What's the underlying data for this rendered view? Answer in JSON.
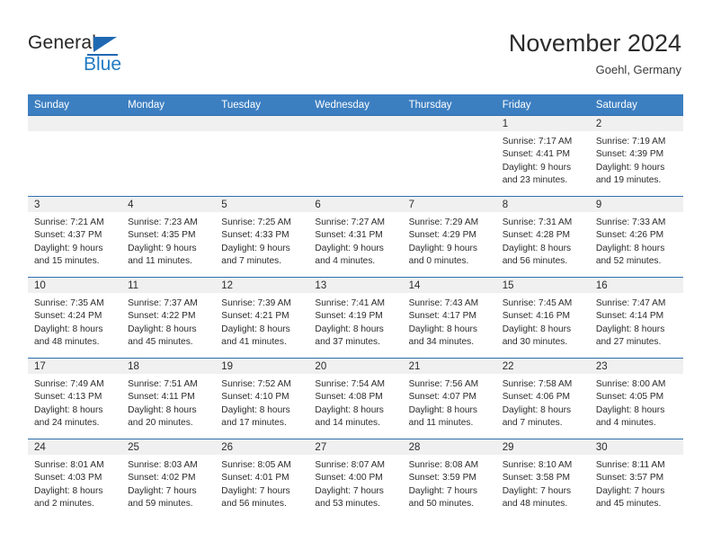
{
  "brand": {
    "name_part1": "General",
    "name_part2": "Blue",
    "logo_icon": "triangle-flag-icon",
    "accent_color": "#1f7ac4"
  },
  "header": {
    "title": "November 2024",
    "subtitle": "Goehl, Germany"
  },
  "theme": {
    "header_row_bg": "#3c7fc1",
    "daynum_band_bg": "#f0f0f0",
    "row_divider": "#2f6fae",
    "text": "#2b2b2b"
  },
  "weekday_headers": [
    "Sunday",
    "Monday",
    "Tuesday",
    "Wednesday",
    "Thursday",
    "Friday",
    "Saturday"
  ],
  "weeks": [
    [
      {
        "empty": true,
        "day": "",
        "sunrise": "",
        "sunset": "",
        "daylight_line1": "",
        "daylight_line2": ""
      },
      {
        "empty": true,
        "day": "",
        "sunrise": "",
        "sunset": "",
        "daylight_line1": "",
        "daylight_line2": ""
      },
      {
        "empty": true,
        "day": "",
        "sunrise": "",
        "sunset": "",
        "daylight_line1": "",
        "daylight_line2": ""
      },
      {
        "empty": true,
        "day": "",
        "sunrise": "",
        "sunset": "",
        "daylight_line1": "",
        "daylight_line2": ""
      },
      {
        "empty": true,
        "day": "",
        "sunrise": "",
        "sunset": "",
        "daylight_line1": "",
        "daylight_line2": ""
      },
      {
        "empty": false,
        "day": "1",
        "sunrise": "Sunrise: 7:17 AM",
        "sunset": "Sunset: 4:41 PM",
        "daylight_line1": "Daylight: 9 hours",
        "daylight_line2": "and 23 minutes."
      },
      {
        "empty": false,
        "day": "2",
        "sunrise": "Sunrise: 7:19 AM",
        "sunset": "Sunset: 4:39 PM",
        "daylight_line1": "Daylight: 9 hours",
        "daylight_line2": "and 19 minutes."
      }
    ],
    [
      {
        "empty": false,
        "day": "3",
        "sunrise": "Sunrise: 7:21 AM",
        "sunset": "Sunset: 4:37 PM",
        "daylight_line1": "Daylight: 9 hours",
        "daylight_line2": "and 15 minutes."
      },
      {
        "empty": false,
        "day": "4",
        "sunrise": "Sunrise: 7:23 AM",
        "sunset": "Sunset: 4:35 PM",
        "daylight_line1": "Daylight: 9 hours",
        "daylight_line2": "and 11 minutes."
      },
      {
        "empty": false,
        "day": "5",
        "sunrise": "Sunrise: 7:25 AM",
        "sunset": "Sunset: 4:33 PM",
        "daylight_line1": "Daylight: 9 hours",
        "daylight_line2": "and 7 minutes."
      },
      {
        "empty": false,
        "day": "6",
        "sunrise": "Sunrise: 7:27 AM",
        "sunset": "Sunset: 4:31 PM",
        "daylight_line1": "Daylight: 9 hours",
        "daylight_line2": "and 4 minutes."
      },
      {
        "empty": false,
        "day": "7",
        "sunrise": "Sunrise: 7:29 AM",
        "sunset": "Sunset: 4:29 PM",
        "daylight_line1": "Daylight: 9 hours",
        "daylight_line2": "and 0 minutes."
      },
      {
        "empty": false,
        "day": "8",
        "sunrise": "Sunrise: 7:31 AM",
        "sunset": "Sunset: 4:28 PM",
        "daylight_line1": "Daylight: 8 hours",
        "daylight_line2": "and 56 minutes."
      },
      {
        "empty": false,
        "day": "9",
        "sunrise": "Sunrise: 7:33 AM",
        "sunset": "Sunset: 4:26 PM",
        "daylight_line1": "Daylight: 8 hours",
        "daylight_line2": "and 52 minutes."
      }
    ],
    [
      {
        "empty": false,
        "day": "10",
        "sunrise": "Sunrise: 7:35 AM",
        "sunset": "Sunset: 4:24 PM",
        "daylight_line1": "Daylight: 8 hours",
        "daylight_line2": "and 48 minutes."
      },
      {
        "empty": false,
        "day": "11",
        "sunrise": "Sunrise: 7:37 AM",
        "sunset": "Sunset: 4:22 PM",
        "daylight_line1": "Daylight: 8 hours",
        "daylight_line2": "and 45 minutes."
      },
      {
        "empty": false,
        "day": "12",
        "sunrise": "Sunrise: 7:39 AM",
        "sunset": "Sunset: 4:21 PM",
        "daylight_line1": "Daylight: 8 hours",
        "daylight_line2": "and 41 minutes."
      },
      {
        "empty": false,
        "day": "13",
        "sunrise": "Sunrise: 7:41 AM",
        "sunset": "Sunset: 4:19 PM",
        "daylight_line1": "Daylight: 8 hours",
        "daylight_line2": "and 37 minutes."
      },
      {
        "empty": false,
        "day": "14",
        "sunrise": "Sunrise: 7:43 AM",
        "sunset": "Sunset: 4:17 PM",
        "daylight_line1": "Daylight: 8 hours",
        "daylight_line2": "and 34 minutes."
      },
      {
        "empty": false,
        "day": "15",
        "sunrise": "Sunrise: 7:45 AM",
        "sunset": "Sunset: 4:16 PM",
        "daylight_line1": "Daylight: 8 hours",
        "daylight_line2": "and 30 minutes."
      },
      {
        "empty": false,
        "day": "16",
        "sunrise": "Sunrise: 7:47 AM",
        "sunset": "Sunset: 4:14 PM",
        "daylight_line1": "Daylight: 8 hours",
        "daylight_line2": "and 27 minutes."
      }
    ],
    [
      {
        "empty": false,
        "day": "17",
        "sunrise": "Sunrise: 7:49 AM",
        "sunset": "Sunset: 4:13 PM",
        "daylight_line1": "Daylight: 8 hours",
        "daylight_line2": "and 24 minutes."
      },
      {
        "empty": false,
        "day": "18",
        "sunrise": "Sunrise: 7:51 AM",
        "sunset": "Sunset: 4:11 PM",
        "daylight_line1": "Daylight: 8 hours",
        "daylight_line2": "and 20 minutes."
      },
      {
        "empty": false,
        "day": "19",
        "sunrise": "Sunrise: 7:52 AM",
        "sunset": "Sunset: 4:10 PM",
        "daylight_line1": "Daylight: 8 hours",
        "daylight_line2": "and 17 minutes."
      },
      {
        "empty": false,
        "day": "20",
        "sunrise": "Sunrise: 7:54 AM",
        "sunset": "Sunset: 4:08 PM",
        "daylight_line1": "Daylight: 8 hours",
        "daylight_line2": "and 14 minutes."
      },
      {
        "empty": false,
        "day": "21",
        "sunrise": "Sunrise: 7:56 AM",
        "sunset": "Sunset: 4:07 PM",
        "daylight_line1": "Daylight: 8 hours",
        "daylight_line2": "and 11 minutes."
      },
      {
        "empty": false,
        "day": "22",
        "sunrise": "Sunrise: 7:58 AM",
        "sunset": "Sunset: 4:06 PM",
        "daylight_line1": "Daylight: 8 hours",
        "daylight_line2": "and 7 minutes."
      },
      {
        "empty": false,
        "day": "23",
        "sunrise": "Sunrise: 8:00 AM",
        "sunset": "Sunset: 4:05 PM",
        "daylight_line1": "Daylight: 8 hours",
        "daylight_line2": "and 4 minutes."
      }
    ],
    [
      {
        "empty": false,
        "day": "24",
        "sunrise": "Sunrise: 8:01 AM",
        "sunset": "Sunset: 4:03 PM",
        "daylight_line1": "Daylight: 8 hours",
        "daylight_line2": "and 2 minutes."
      },
      {
        "empty": false,
        "day": "25",
        "sunrise": "Sunrise: 8:03 AM",
        "sunset": "Sunset: 4:02 PM",
        "daylight_line1": "Daylight: 7 hours",
        "daylight_line2": "and 59 minutes."
      },
      {
        "empty": false,
        "day": "26",
        "sunrise": "Sunrise: 8:05 AM",
        "sunset": "Sunset: 4:01 PM",
        "daylight_line1": "Daylight: 7 hours",
        "daylight_line2": "and 56 minutes."
      },
      {
        "empty": false,
        "day": "27",
        "sunrise": "Sunrise: 8:07 AM",
        "sunset": "Sunset: 4:00 PM",
        "daylight_line1": "Daylight: 7 hours",
        "daylight_line2": "and 53 minutes."
      },
      {
        "empty": false,
        "day": "28",
        "sunrise": "Sunrise: 8:08 AM",
        "sunset": "Sunset: 3:59 PM",
        "daylight_line1": "Daylight: 7 hours",
        "daylight_line2": "and 50 minutes."
      },
      {
        "empty": false,
        "day": "29",
        "sunrise": "Sunrise: 8:10 AM",
        "sunset": "Sunset: 3:58 PM",
        "daylight_line1": "Daylight: 7 hours",
        "daylight_line2": "and 48 minutes."
      },
      {
        "empty": false,
        "day": "30",
        "sunrise": "Sunrise: 8:11 AM",
        "sunset": "Sunset: 3:57 PM",
        "daylight_line1": "Daylight: 7 hours",
        "daylight_line2": "and 45 minutes."
      }
    ]
  ]
}
